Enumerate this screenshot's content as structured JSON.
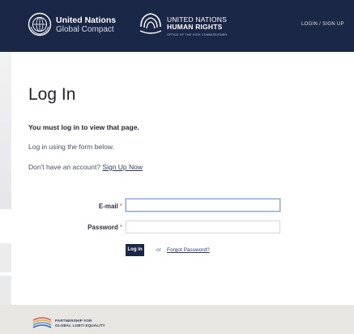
{
  "header": {
    "un_line1": "United Nations",
    "un_line2": "Global Compact",
    "ohchr_line1": "UNITED NATIONS",
    "ohchr_line2": "HUMAN RIGHTS",
    "ohchr_line3": "OFFICE OF THE HIGH COMMISSIONER",
    "login_signup": "LOGIN / SIGN UP",
    "bg_color": "#1b2747"
  },
  "main": {
    "title": "Log In",
    "warning": "You must log in to view that page.",
    "instruction": "Log in using the form below.",
    "account_prompt": "Don't have an account?",
    "signup_link": "Sign Up Now"
  },
  "form": {
    "email_label": "E-mail",
    "password_label": "Password",
    "required_marker": "*",
    "email_value": "",
    "password_value": "",
    "login_button": "Log in",
    "or_text": "or",
    "forgot_password": "Forgot Password?"
  },
  "footer": {
    "partner_line1": "PARTNERSHIP FOR",
    "partner_line2": "GLOBAL LGBTI EQUALITY"
  },
  "icons": {
    "un_emblem": "un-globe-emblem-icon",
    "ohchr_emblem": "human-rights-emblem-icon",
    "partner_logo": "partnership-logo-icon"
  }
}
